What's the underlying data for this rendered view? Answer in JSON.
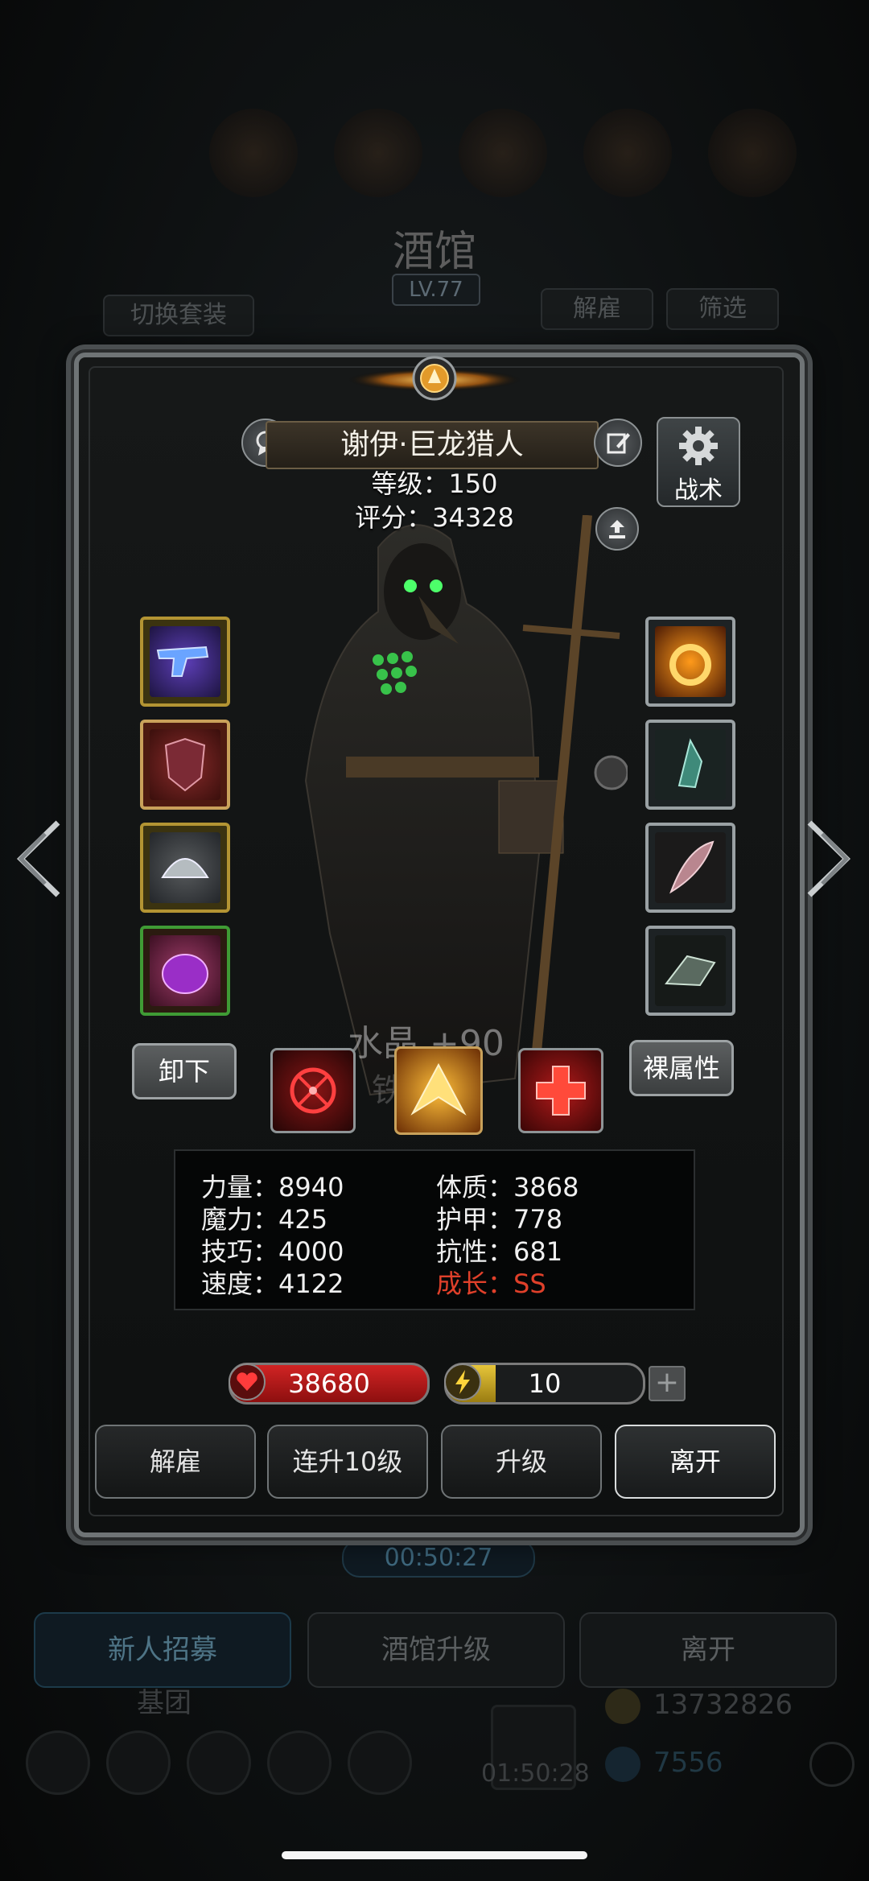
{
  "background": {
    "title": "酒馆",
    "level": "LV.77",
    "switch_outfit": "切换套装",
    "dismiss": "解雇",
    "filter": "筛选",
    "timer": "00:50:27",
    "tabs": [
      "新人招募",
      "酒馆升级",
      "离开"
    ],
    "group_label": "基团",
    "countdown": "01:50:28",
    "gold": "13732826",
    "gems": "7556"
  },
  "hero": {
    "name": "谢伊·巨龙猎人",
    "level_line": "等级：150",
    "score_line": "评分：34328",
    "tactics_label": "战术"
  },
  "buttons": {
    "unequip": "卸下",
    "base_attributes": "裸属性"
  },
  "overlay_text": {
    "crystal": "水晶 +90",
    "ghost": "铁 50"
  },
  "stats": {
    "left": [
      "力量：8940",
      "魔力：425",
      "技巧：4000",
      "速度：4122"
    ],
    "right": [
      "体质：3868",
      "护甲：778",
      "抗性：681"
    ],
    "growth": "成长：SS"
  },
  "bars": {
    "hp": "38680",
    "energy": "10",
    "energy_fraction": 0.25
  },
  "actions": [
    "解雇",
    "连升10级",
    "升级",
    "离开"
  ],
  "colors": {
    "growth": "#e0402a",
    "hp": "#d12424",
    "energy": "#e6c53a"
  }
}
